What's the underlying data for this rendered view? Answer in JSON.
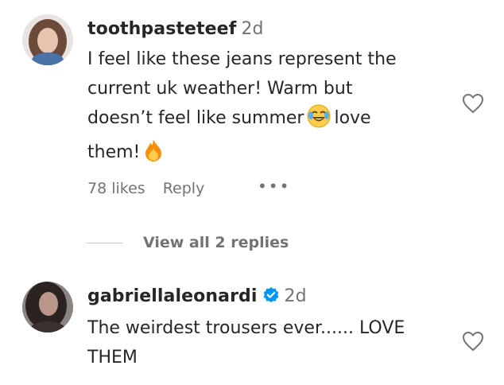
{
  "comments": [
    {
      "username": "toothpasteteef",
      "time": "2d",
      "text_lines": [
        "I feel like these jeans represent the",
        "current uk weather! Warm but",
        "doesn’t feel like summer",
        "love",
        "them!"
      ],
      "emojis": [
        "laughing-tears-emoji",
        "fire-emoji"
      ],
      "likes": "78 likes",
      "reply": "Reply",
      "more": "•••",
      "view_replies": "View all 2 replies"
    },
    {
      "username": "gabriellaleonardi",
      "time": "2d",
      "verified": true,
      "text_lines": [
        "The weirdest trousers ever...... LOVE",
        "THEM"
      ]
    }
  ],
  "colors": {
    "text": "#262626",
    "secondary": "#737373",
    "verified": "#0095f6"
  }
}
